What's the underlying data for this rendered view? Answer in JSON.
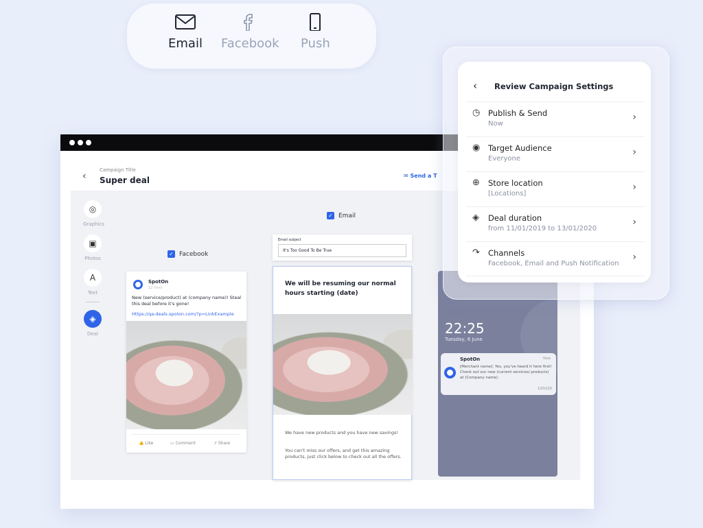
{
  "channels": [
    {
      "label": "Email",
      "icon": "envelope-icon",
      "active": true
    },
    {
      "label": "Facebook",
      "icon": "facebook-icon",
      "active": false
    },
    {
      "label": "Push",
      "icon": "phone-icon",
      "active": false
    }
  ],
  "editor": {
    "title_label": "Campaign Title",
    "title": "Super deal",
    "send_test": "Send a T",
    "tools": [
      {
        "label": "Graphics",
        "icon": "graphics-icon"
      },
      {
        "label": "Photos",
        "icon": "photo-add-icon"
      },
      {
        "label": "Text",
        "icon": "text-icon"
      },
      {
        "label": "Deal",
        "icon": "tag-icon"
      }
    ],
    "facebook": {
      "checkbox_label": "Facebook",
      "page": "SpotOn",
      "time": "12 mins",
      "text": "New (service/product) at (company name)! Steal this deal before it's gone!",
      "link": "Https://qa-deals.spoton.com/?p=LinkExample",
      "actions": [
        "Like",
        "Comment",
        "Share"
      ]
    },
    "email": {
      "checkbox_label": "Email",
      "subject_label": "Email subject",
      "subject_value": "It's Too Good To Be True",
      "headline": "We will be resuming our normal hours starting (date)",
      "body1": "We have new products and you have new savings!",
      "body2": "You can't miss our offers, and get this amazing products, just click below to check out all the offers."
    },
    "push": {
      "time": "22:25",
      "date": "Tuesday, 6 June",
      "app": "SpotOn",
      "when": "Now",
      "text": "[Merchant name]: Yes, you've heard it here first! Check out our new (current services/ products) at (Company name).",
      "count": "120/120"
    }
  },
  "review": {
    "title": "Review Campaign Settings",
    "rows": [
      {
        "title": "Publish & Send",
        "sub": "Now",
        "icon": "clock-icon"
      },
      {
        "title": "Target Audience",
        "sub": "Everyone",
        "icon": "audience-icon"
      },
      {
        "title": "Store location",
        "sub": "[Locations]",
        "icon": "location-icon"
      },
      {
        "title": "Deal duration",
        "sub": "from 11/01/2019 to 13/01/2020",
        "icon": "tag-icon"
      },
      {
        "title": "Channels",
        "sub": "Facebook, Email and Push Notification",
        "icon": "share-icon"
      }
    ]
  },
  "colors": {
    "accent": "#2f64e8",
    "background": "#e9eefb",
    "phone": "#7b819c"
  }
}
